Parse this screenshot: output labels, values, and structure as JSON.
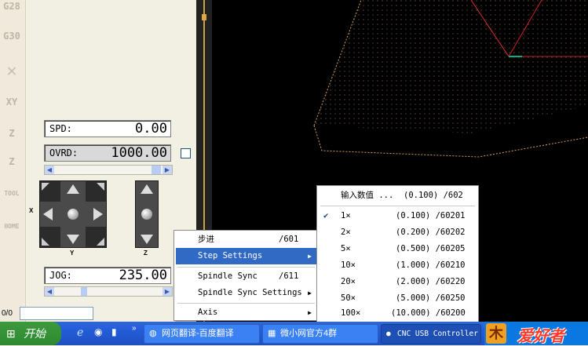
{
  "sidebar": {
    "buttons": [
      "G28",
      "G30",
      "XY",
      "Z",
      "Z",
      "TOOL",
      "HOME"
    ]
  },
  "dro": {
    "spd_label": "SPD:",
    "spd_value": "0.00",
    "ovrd_label": "OVRD:",
    "ovrd_value": "1000.00",
    "jog_label": "JOG:",
    "jog_value": "235.00"
  },
  "jogpad": {
    "x_label": "X",
    "y_label": "Y",
    "z_label": "Z"
  },
  "status": {
    "counter": "0/0"
  },
  "context_menu": {
    "items": [
      {
        "label": "步进",
        "shortcut": "/601"
      },
      {
        "label": "Step Settings",
        "submenu": true
      },
      {
        "label": "Spindle Sync",
        "shortcut": "/611"
      },
      {
        "label": "Spindle Sync Settings",
        "submenu": true
      },
      {
        "label": "Axis",
        "submenu": true
      }
    ]
  },
  "submenu": {
    "items": [
      {
        "label": "输入数值 ...",
        "value": "(0.100) /602"
      },
      {
        "label": "1×",
        "value": "(0.100) /60201",
        "checked": true
      },
      {
        "label": "2×",
        "value": "(0.200) /60202"
      },
      {
        "label": "5×",
        "value": "(0.500) /60205"
      },
      {
        "label": "10×",
        "value": "(1.000) /60210"
      },
      {
        "label": "20×",
        "value": "(2.000) /60220"
      },
      {
        "label": "50×",
        "value": "(5.000) /60250"
      },
      {
        "label": "100×",
        "value": "(10.000) /60200"
      }
    ]
  },
  "taskbar": {
    "start_label": "开始",
    "tasks": [
      {
        "label": "网页翻译-百度翻译",
        "icon": "browser-icon"
      },
      {
        "label": "微小网官方4群",
        "icon": "chat-icon"
      },
      {
        "label": "CNC USB Controller",
        "icon": "cnc-icon"
      }
    ],
    "brand_text": "爱好者"
  }
}
